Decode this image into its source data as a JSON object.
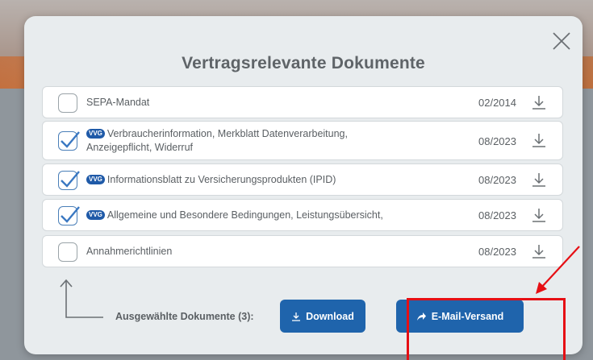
{
  "modal": {
    "title": "Vertragsrelevante Dokumente",
    "close_icon": "close-icon"
  },
  "documents": [
    {
      "checked": false,
      "badge": "",
      "label_line1": "SEPA-Mandat",
      "label_line2": "",
      "date": "02/2014"
    },
    {
      "checked": true,
      "badge": "VVG",
      "label_line1": "Verbraucherinformation, Merkblatt Datenverarbeitung,",
      "label_line2": "Anzeigepflicht, Widerruf",
      "date": "08/2023"
    },
    {
      "checked": true,
      "badge": "VVG",
      "label_line1": "Informationsblatt zu Versicherungsprodukten (IPID)",
      "label_line2": "",
      "date": "08/2023"
    },
    {
      "checked": true,
      "badge": "VVG",
      "label_line1": "Allgemeine und Besondere Bedingungen, Leistungsübersicht,",
      "label_line2": "",
      "date": "08/2023"
    },
    {
      "checked": false,
      "badge": "",
      "label_line1": "Annahmerichtlinien",
      "label_line2": "",
      "date": "08/2023"
    }
  ],
  "footer": {
    "selected_label": "Ausgewählte Dokumente (3):",
    "download_label": "Download",
    "email_label": "E-Mail-Versand"
  },
  "colors": {
    "accent": "#1f64ac",
    "annotation_red": "#e60f14"
  }
}
